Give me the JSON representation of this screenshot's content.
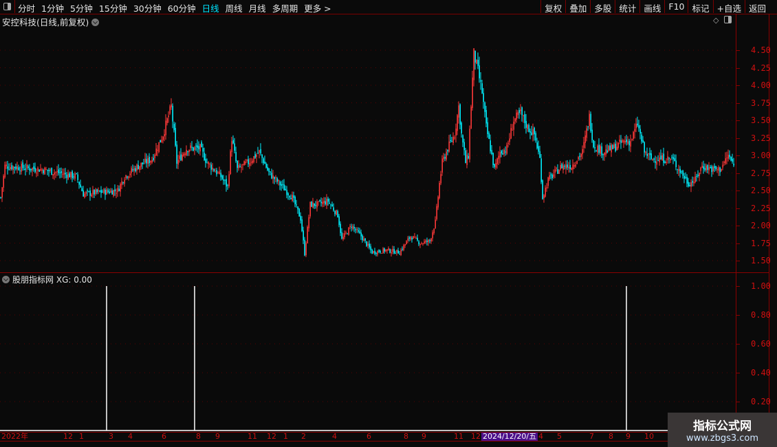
{
  "toolbar": {
    "periods": [
      "分时",
      "1分钟",
      "5分钟",
      "15分钟",
      "30分钟",
      "60分钟",
      "日线",
      "周线",
      "月线",
      "多周期",
      "更多 >"
    ],
    "active_period": "日线",
    "right_buttons": [
      "复权",
      "叠加",
      "多股",
      "统计",
      "画线",
      "F10",
      "标记",
      "+自选",
      "返回"
    ]
  },
  "main_chart": {
    "title": "安控科技(日线,前复权)",
    "price_ticks": [
      "4.50",
      "4.25",
      "4.00",
      "3.75",
      "3.50",
      "3.25",
      "3.00",
      "2.75",
      "2.50",
      "2.25",
      "2.00",
      "1.75",
      "1.50"
    ],
    "colors": {
      "up": "#ff3838",
      "down": "#00f0ff",
      "grid": "#5a0000",
      "axis": "#8b0000"
    }
  },
  "indicator": {
    "title": "股朋指标网",
    "value_label": "XG: 0.00",
    "ticks": [
      "1.00",
      "0.80",
      "0.60",
      "0.40",
      "0.20"
    ]
  },
  "time_axis": {
    "labels": [
      "2022年",
      "12",
      "1",
      "3",
      "4",
      "6",
      "8",
      "9",
      "11",
      "12",
      "1",
      "2",
      "4",
      "6",
      "8",
      "9",
      "11",
      "12",
      "4",
      "5",
      "7",
      "8",
      "9",
      "10"
    ],
    "cursor_date": "2024/12/20/五"
  },
  "watermark": {
    "title": "指标公式网",
    "url": "www.zbgs3.com"
  },
  "chart_data": {
    "type": "candlestick",
    "bar_count": 534,
    "ylim": [
      1.5,
      4.5
    ],
    "close_keypoints": [
      [
        0,
        2.4
      ],
      [
        3,
        2.85
      ],
      [
        30,
        2.8
      ],
      [
        55,
        2.7
      ],
      [
        60,
        2.45
      ],
      [
        85,
        2.5
      ],
      [
        90,
        2.7
      ],
      [
        100,
        2.85
      ],
      [
        110,
        2.95
      ],
      [
        118,
        3.3
      ],
      [
        124,
        3.7
      ],
      [
        128,
        2.9
      ],
      [
        135,
        3.1
      ],
      [
        145,
        3.1
      ],
      [
        150,
        2.9
      ],
      [
        160,
        2.7
      ],
      [
        165,
        2.55
      ],
      [
        168,
        3.25
      ],
      [
        172,
        2.8
      ],
      [
        180,
        2.9
      ],
      [
        188,
        3.05
      ],
      [
        195,
        2.75
      ],
      [
        205,
        2.55
      ],
      [
        212,
        2.4
      ],
      [
        218,
        2.1
      ],
      [
        221,
        1.6
      ],
      [
        225,
        2.3
      ],
      [
        230,
        2.3
      ],
      [
        238,
        2.35
      ],
      [
        245,
        2.15
      ],
      [
        248,
        1.8
      ],
      [
        255,
        2.0
      ],
      [
        262,
        1.85
      ],
      [
        270,
        1.62
      ],
      [
        280,
        1.65
      ],
      [
        290,
        1.62
      ],
      [
        298,
        1.85
      ],
      [
        305,
        1.75
      ],
      [
        312,
        1.78
      ],
      [
        316,
        2.05
      ],
      [
        319,
        2.6
      ],
      [
        321,
        2.9
      ],
      [
        325,
        3.1
      ],
      [
        330,
        3.3
      ],
      [
        333,
        3.7
      ],
      [
        335,
        3.3
      ],
      [
        338,
        2.9
      ],
      [
        340,
        3.0
      ],
      [
        344,
        4.45
      ],
      [
        347,
        4.2
      ],
      [
        350,
        3.9
      ],
      [
        353,
        3.4
      ],
      [
        356,
        3.1
      ],
      [
        359,
        2.8
      ],
      [
        363,
        3.05
      ],
      [
        368,
        3.1
      ],
      [
        373,
        3.5
      ],
      [
        378,
        3.6
      ],
      [
        383,
        3.4
      ],
      [
        388,
        3.3
      ],
      [
        392,
        2.95
      ],
      [
        394,
        2.4
      ],
      [
        398,
        2.65
      ],
      [
        403,
        2.75
      ],
      [
        408,
        2.85
      ],
      [
        415,
        2.85
      ],
      [
        423,
        3.05
      ],
      [
        428,
        3.55
      ],
      [
        431,
        3.15
      ],
      [
        438,
        3.05
      ],
      [
        445,
        3.1
      ],
      [
        453,
        3.2
      ],
      [
        458,
        3.2
      ],
      [
        463,
        3.45
      ],
      [
        468,
        3.05
      ],
      [
        473,
        2.95
      ],
      [
        480,
        2.95
      ],
      [
        488,
        2.95
      ],
      [
        495,
        2.75
      ],
      [
        500,
        2.6
      ],
      [
        505,
        2.65
      ],
      [
        510,
        2.85
      ],
      [
        518,
        2.8
      ],
      [
        523,
        2.8
      ],
      [
        529,
        3.0
      ],
      [
        533,
        2.85
      ]
    ],
    "xg_signals": [
      {
        "bar": 77,
        "value": 1.0
      },
      {
        "bar": 141,
        "value": 1.0
      },
      {
        "bar": 455,
        "value": 1.0
      }
    ],
    "xg_ylim": [
      0,
      1.0
    ]
  }
}
